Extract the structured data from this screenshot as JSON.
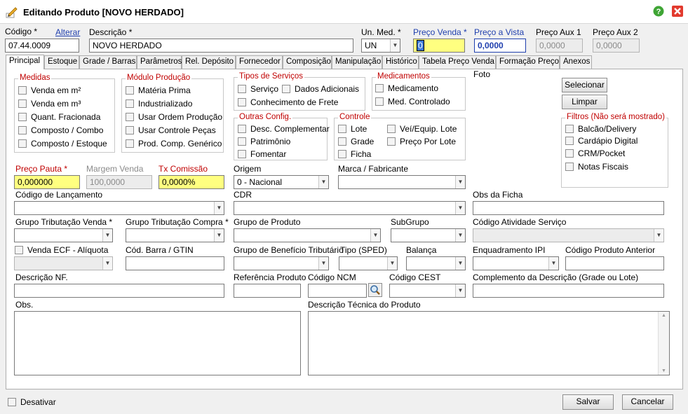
{
  "window": {
    "title": "Editando Produto [NOVO HERDADO]"
  },
  "header": {
    "codigo_label": "Código",
    "alterar_link": "Alterar",
    "codigo_value": "07.44.0009",
    "descricao_label": "Descrição",
    "descricao_value": "NOVO HERDADO",
    "unmed_label": "Un. Med.",
    "unmed_value": "UN",
    "preco_venda_label": "Preço Venda",
    "preco_venda_value": "0",
    "preco_vista_label": "Preço a Vista",
    "preco_vista_value": "0,0000",
    "aux1_label": "Preço Aux 1",
    "aux1_value": "0,0000",
    "aux2_label": "Preço Aux 2",
    "aux2_value": "0,0000"
  },
  "tabs": [
    "Principal",
    "Estoque",
    "Grade / Barras",
    "Parâmetros",
    "Rel. Depósito",
    "Fornecedor",
    "Composição",
    "Manipulação",
    "Histórico",
    "Tabela Preço Venda",
    "Formação Preço",
    "Anexos"
  ],
  "medidas": {
    "title": "Medidas",
    "items": [
      "Venda em m²",
      "Venda em m³",
      "Quant. Fracionada",
      "Composto / Combo",
      "Composto / Estoque"
    ]
  },
  "producao": {
    "title": "Módulo Produção",
    "items": [
      "Matéria Prima",
      "Industrializado",
      "Usar Ordem Produção",
      "Usar Controle Peças",
      "Prod. Comp. Genérico"
    ]
  },
  "servicos": {
    "title": "Tipos de Serviços",
    "servico": "Serviço",
    "dados": "Dados Adicionais",
    "frete": "Conhecimento de Frete"
  },
  "medicamentos": {
    "title": "Medicamentos",
    "items": [
      "Medicamento",
      "Med. Controlado"
    ]
  },
  "outras": {
    "title": "Outras Config.",
    "items": [
      "Desc. Complementar",
      "Patrimônio",
      "Fomentar"
    ]
  },
  "controle": {
    "title": "Controle",
    "lote": "Lote",
    "grade": "Grade",
    "ficha": "Ficha",
    "vei": "Veí/Equip. Lote",
    "preco_lote": "Preço Por Lote"
  },
  "foto": {
    "label": "Foto",
    "selecionar": "Selecionar",
    "limpar": "Limpar"
  },
  "filtros": {
    "title": "Filtros (Não será mostrado)",
    "items": [
      "Balcão/Delivery",
      "Cardápio Digital",
      "CRM/Pocket",
      "Notas Fiscais"
    ]
  },
  "fields": {
    "preco_pauta_label": "Preço Pauta",
    "preco_pauta_value": "0,000000",
    "margem_label": "Margem Venda",
    "margem_value": "100,0000",
    "comissao_label": "Tx Comissão",
    "comissao_value": "0,0000%",
    "origem_label": "Origem",
    "origem_value": "0 - Nacional",
    "marca_label": "Marca / Fabricante",
    "lancamento_label": "Código de Lançamento",
    "cdr_label": "CDR",
    "obs_ficha_label": "Obs da Ficha",
    "trib_venda_label": "Grupo Tributação Venda",
    "trib_compra_label": "Grupo Tributação Compra",
    "grupo_produto_label": "Grupo de Produto",
    "subgrupo_label": "SubGrupo",
    "atividade_label": "Código Atividade Serviço",
    "venda_ecf_label": "Venda ECF - Alíquota",
    "barra_label": "Cód. Barra / GTIN",
    "beneficio_label": "Grupo de Benefício Tributário",
    "tipo_sped_label": "Tipo (SPED)",
    "balanca_label": "Balança",
    "ipi_label": "Enquadramento IPI",
    "anterior_label": "Código Produto Anterior",
    "descricao_nf_label": "Descrição NF.",
    "referencia_label": "Referência Produto",
    "ncm_label": "Código NCM",
    "cest_label": "Código CEST",
    "complemento_label": "Complemento da Descrição  (Grade ou Lote)",
    "obs_label": "Obs.",
    "desc_tecnica_label": "Descrição Técnica do Produto"
  },
  "footer": {
    "desativar": "Desativar",
    "salvar": "Salvar",
    "cancelar": "Cancelar"
  },
  "colors": {
    "required_label": "#c00000",
    "link_blue": "#1f3fae",
    "highlight_yellow": "#ffff80"
  }
}
